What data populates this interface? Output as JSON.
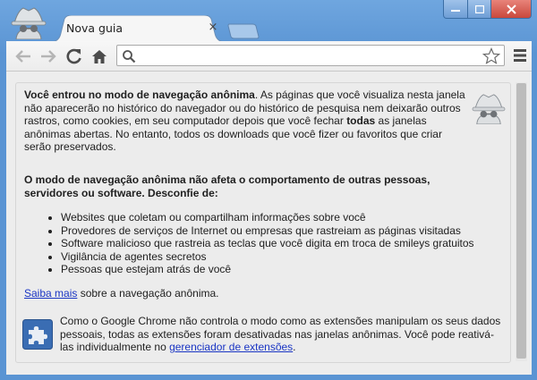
{
  "tab": {
    "title": "Nova guia",
    "close_glyph": "×"
  },
  "omnibox": {
    "value": "",
    "placeholder": ""
  },
  "icons": {
    "back": "back-arrow-icon",
    "forward": "forward-arrow-icon",
    "reload": "reload-icon",
    "home": "home-icon",
    "search": "search-icon",
    "star": "star-icon",
    "menu": "menu-icon",
    "incognito": "incognito-icon",
    "extension": "puzzle-piece-icon"
  },
  "colors": {
    "frame": "#5a94d3",
    "link": "#1a35c4",
    "close_button": "#c9483c"
  },
  "intro": {
    "bold_lead": "Você entrou no modo de navegação anônima",
    "text_a": ". As páginas que você visualiza nesta janela não aparecerão no histórico do navegador ou do histórico de pesquisa nem deixarão outros rastros, como cookies, em seu computador depois que você fechar ",
    "bold_all": "todas",
    "text_b": " as janelas anônimas abertas. No entanto, todos os downloads que você fizer ou favoritos que criar serão preservados."
  },
  "warning_heading": "O modo de navegação anônima não afeta o comportamento de outras pessoas, servidores ou software. Desconfie de:",
  "warnings": [
    "Websites que coletam ou compartilham informações sobre você",
    "Provedores de serviços de Internet ou empresas que rastreiam as páginas visitadas",
    "Software malicioso que rastreia as teclas que você digita em troca de smileys gratuitos",
    "Vigilância de agentes secretos",
    "Pessoas que estejam atrás de você"
  ],
  "learn_more": {
    "link": "Saiba mais",
    "text": " sobre a navegação anônima."
  },
  "extensions": {
    "text_a": "Como o Google Chrome não controla o modo como as extensões manipulam os seus dados pessoais, todas as extensões foram desativadas nas janelas anônimas. Você pode reativá-las individualmente no ",
    "link": "gerenciador de extensões",
    "text_b": "."
  }
}
